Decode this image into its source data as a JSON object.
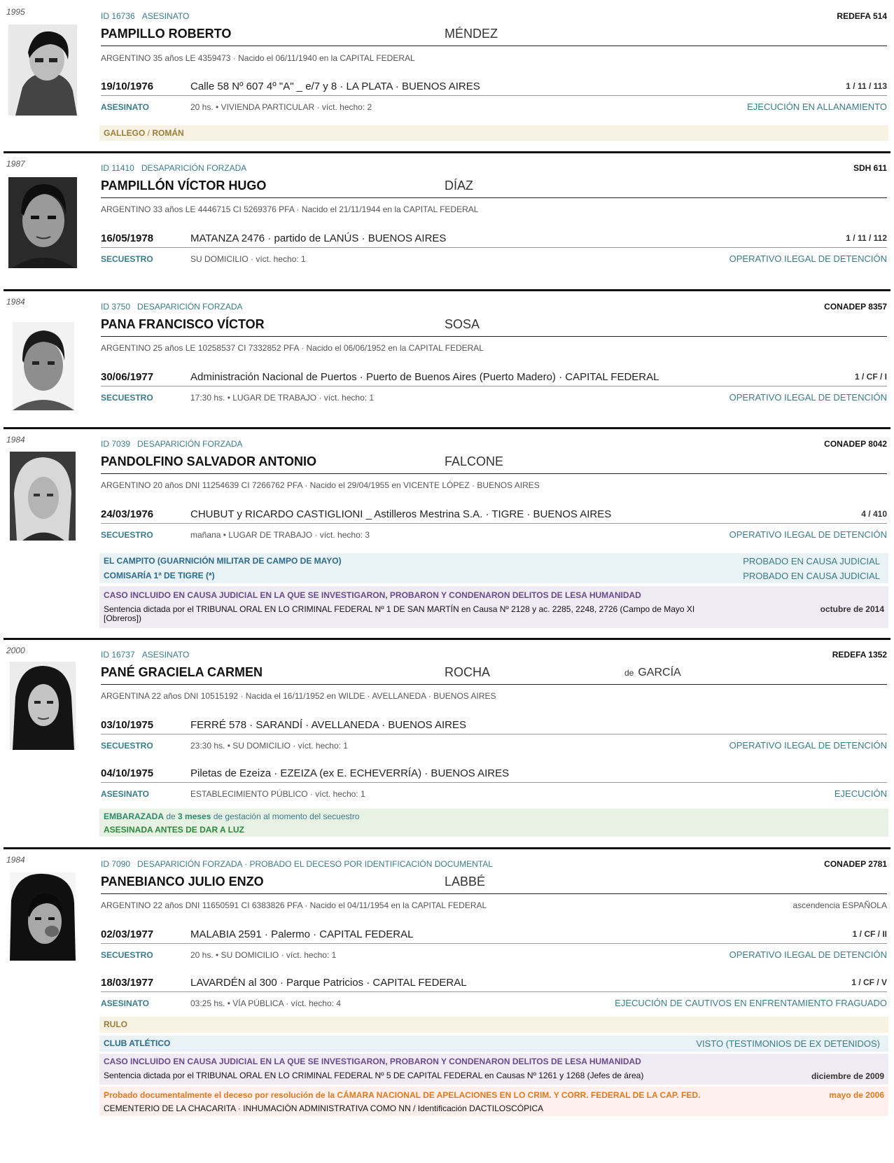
{
  "records": [
    {
      "year": "1995",
      "id": "ID 16736",
      "category": "ASESINATO",
      "source": "REDEFA  514",
      "surname": "PAMPILLO  ROBERTO",
      "second_surname": "MÉNDEZ",
      "info": "ARGENTINO    35 años    LE 4359473  ·  Nacido el 06/11/1940 en la CAPITAL FEDERAL",
      "events": [
        {
          "date": "19/10/1976",
          "place": "Calle 58 Nº 607  4º \"A\" _ e/7 y 8   ·   LA PLATA · BUENOS AIRES",
          "code": "1 / 11 / 113",
          "type": "ASESINATO",
          "detail": "20 hs.  •  VIVIENDA PARTICULAR  ·  víct. hecho: 2",
          "classification": "EJECUCIÓN EN ALLANAMIENTO"
        }
      ],
      "alias_a": "GALLEGO",
      "alias_sep": " / ",
      "alias_b": "ROMÁN"
    },
    {
      "year": "1987",
      "id": "ID 11410",
      "category": "DESAPARICIÓN FORZADA",
      "source": "SDH  611",
      "surname": "PAMPILLÓN  VÍCTOR HUGO",
      "second_surname": "DÍAZ",
      "info": "ARGENTINO    33 años    LE 4446715    CI 5269376 PFA  ·  Nacido el 21/11/1944 en la CAPITAL FEDERAL",
      "events": [
        {
          "date": "16/05/1978",
          "place": "MATANZA 2476   ·   partido de LANÚS · BUENOS AIRES",
          "code": "1 / 11 / 112",
          "type": "SECUESTRO",
          "detail": "SU DOMICILIO  ·  víct. hecho: 1",
          "classification": "OPERATIVO ILEGAL DE DETENCIÓN"
        }
      ]
    },
    {
      "year": "1984",
      "id": "ID 3750",
      "category": "DESAPARICIÓN FORZADA",
      "source": "CONADEP  8357",
      "surname": "PANA  FRANCISCO VÍCTOR",
      "second_surname": "SOSA",
      "info": "ARGENTINO    25 años    LE 10258537    CI 7332852 PFA  ·  Nacido el 06/06/1952 en la CAPITAL FEDERAL",
      "events": [
        {
          "date": "30/06/1977",
          "place": "Administración Nacional de Puertos   ·  Puerto de Buenos Aires (Puerto Madero)   ·  CAPITAL FEDERAL",
          "code": "1 / CF / I",
          "type": "SECUESTRO",
          "detail": "17:30 hs.  •  LUGAR DE TRABAJO  ·  víct. hecho: 1",
          "classification": "OPERATIVO ILEGAL DE DETENCIÓN"
        }
      ]
    },
    {
      "year": "1984",
      "id": "ID 7039",
      "category": "DESAPARICIÓN FORZADA",
      "source": "CONADEP  8042",
      "surname": "PANDOLFINO  SALVADOR ANTONIO",
      "second_surname": "FALCONE",
      "info": "ARGENTINO    20 años    DNI 11254639    CI 7266762 PFA  ·  Nacido el 29/04/1955 en VICENTE LÓPEZ · BUENOS AIRES",
      "events": [
        {
          "date": "24/03/1976",
          "place": "CHUBUT y RICARDO CASTIGLIONI _ Astilleros Mestrina S.A.   ·   TIGRE · BUENOS AIRES",
          "code": "4 / 410",
          "type": "SECUESTRO",
          "detail": "mañana  •  LUGAR DE TRABAJO  ·  víct. hecho: 3",
          "classification": "OPERATIVO ILEGAL DE DETENCIÓN"
        }
      ],
      "centers": [
        {
          "name": "EL CAMPITO (GUARNICIÓN MILITAR DE CAMPO DE MAYO)",
          "status": "PROBADO EN CAUSA JUDICIAL"
        },
        {
          "name": "COMISARÍA 1ª DE TIGRE (*)",
          "status": "PROBADO EN CAUSA JUDICIAL"
        }
      ],
      "case_title": "CASO INCLUIDO EN CAUSA JUDICIAL EN LA QUE SE INVESTIGARON, PROBARON Y CONDENARON DELITOS DE LESA HUMANIDAD",
      "case_text": "Sentencia dictada por el TRIBUNAL ORAL EN LO CRIMINAL FEDERAL Nº 1 DE SAN MARTÍN en Causa Nº 2128 y ac. 2285, 2248, 2726 (Campo de Mayo XI",
      "case_text2": "[Obreros])",
      "case_date": "octubre de 2014"
    },
    {
      "year": "2000",
      "id": "ID 16737",
      "category": "ASESINATO",
      "source": "REDEFA  1352",
      "surname": "PANÉ  GRACIELA CARMEN",
      "second_surname": "ROCHA",
      "married_prefix": "de",
      "married_name": "GARCÍA",
      "info": "ARGENTINA    22 años    DNI 10515192  ·  Nacida el 16/11/1952 en WILDE · AVELLANEDA · BUENOS AIRES",
      "events": [
        {
          "date": "03/10/1975",
          "place": "FERRÉ 578   ·   SARANDÍ · AVELLANEDA · BUENOS AIRES",
          "code": "",
          "type": "SECUESTRO",
          "detail": "23:30 hs.  •  SU DOMICILIO  ·  víct. hecho: 1",
          "classification": "OPERATIVO ILEGAL DE DETENCIÓN"
        },
        {
          "date": "04/10/1975",
          "place": "Piletas de Ezeiza   ·   EZEIZA (ex E. ECHEVERRÍA) · BUENOS AIRES",
          "code": "",
          "type": "ASESINATO",
          "detail": "ESTABLECIMIENTO PÚBLICO  ·  víct. hecho: 1",
          "classification": "EJECUCIÓN"
        }
      ],
      "pregnant_a": "EMBARAZADA",
      "pregnant_b": " de ",
      "pregnant_c": "3 meses",
      "pregnant_d": " de gestación al momento del secuestro",
      "pregnant_note": "ASESINADA ANTES DE DAR A LUZ"
    },
    {
      "year": "1984",
      "id": "ID 7090",
      "category": "DESAPARICIÓN FORZADA  ·  PROBADO EL DECESO POR IDENTIFICACIÓN DOCUMENTAL",
      "source": "CONADEP  2781",
      "surname": "PANEBIANCO  JULIO ENZO",
      "second_surname": "LABBÉ",
      "info": "ARGENTINO    22 años    DNI 11650591    CI 6383826 PFA  ·  Nacido el 04/11/1954 en la CAPITAL FEDERAL",
      "ancestry": "ascendencia ESPAÑOLA",
      "events": [
        {
          "date": "02/03/1977",
          "place": "MALABIA 2591  ·  Palermo  ·  CAPITAL FEDERAL",
          "code": "1 / CF / II",
          "type": "SECUESTRO",
          "detail": "20 hs.  •  SU DOMICILIO  ·  víct. hecho: 1",
          "classification": "OPERATIVO ILEGAL DE DETENCIÓN"
        },
        {
          "date": "18/03/1977",
          "place": "LAVARDÉN al 300  ·  Parque Patricios  ·  CAPITAL FEDERAL",
          "code": "1 / CF / V",
          "type": "ASESINATO",
          "detail": "03:25 hs.  •  VÍA PÚBLICA  ·  víct. hecho: 4",
          "classification": "EJECUCIÓN DE CAUTIVOS EN ENFRENTAMIENTO FRAGUADO"
        }
      ],
      "alias_a": "RULO",
      "centers": [
        {
          "name": "CLUB ATLÉTICO",
          "status": "VISTO (TESTIMONIOS DE EX DETENIDOS)"
        }
      ],
      "case_title": "CASO INCLUIDO EN CAUSA JUDICIAL EN LA QUE SE INVESTIGARON, PROBARON Y CONDENARON DELITOS DE LESA HUMANIDAD",
      "case_text": "Sentencia dictada por el TRIBUNAL ORAL EN LO CRIMINAL FEDERAL Nº 5 DE CAPITAL FEDERAL en Causas Nº 1261 y 1268 (Jefes de área)",
      "case_date": "diciembre de 2009",
      "death_text": "Probado documentalmente el deceso por resolución de la CÁMARA NACIONAL DE APELACIONES EN LO CRIM. Y CORR. FEDERAL DE LA CAP. FED.",
      "death_date": "mayo de 2006",
      "death_detail": "CEMENTERIO DE LA CHACARITA · INHUMACIÓN ADMINISTRATIVA COMO NN  /  Identificación DACTILOSCÓPICA"
    }
  ]
}
